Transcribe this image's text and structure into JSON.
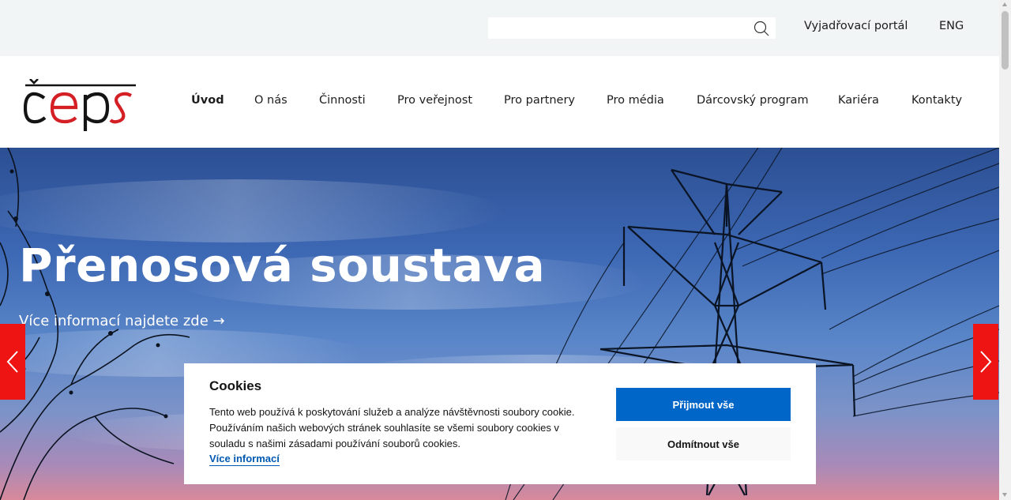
{
  "topbar": {
    "search": {
      "value": "",
      "placeholder": ""
    },
    "portal_link": "Vyjadřovací portál",
    "lang_link": "ENG"
  },
  "logo": {
    "alt_text": "čeps"
  },
  "nav": {
    "items": [
      {
        "label": "Úvod",
        "active": true
      },
      {
        "label": "O nás"
      },
      {
        "label": "Činnosti"
      },
      {
        "label": "Pro veřejnost"
      },
      {
        "label": "Pro partnery"
      },
      {
        "label": "Pro média"
      },
      {
        "label": "Dárcovský program"
      },
      {
        "label": "Kariéra"
      },
      {
        "label": "Kontakty"
      }
    ]
  },
  "hero": {
    "title": "Přenosová soustava",
    "link": "Více informací najdete zde →"
  },
  "cookie": {
    "title": "Cookies",
    "text": "Tento web používá k poskytování služeb a analýze návštěvnosti soubory cookie. Používáním našich webových stránek souhlasíte se všemi soubory cookies v souladu s našimi zásadami používání souborů cookies.",
    "more_link": "Více informací",
    "accept_label": "Přijmout vše",
    "reject_label": "Odmítnout vše"
  },
  "colors": {
    "accent_red": "#ee1414",
    "button_blue": "#0066c7",
    "link_blue": "#0059b3",
    "topbar_bg": "#f1f5f5"
  }
}
